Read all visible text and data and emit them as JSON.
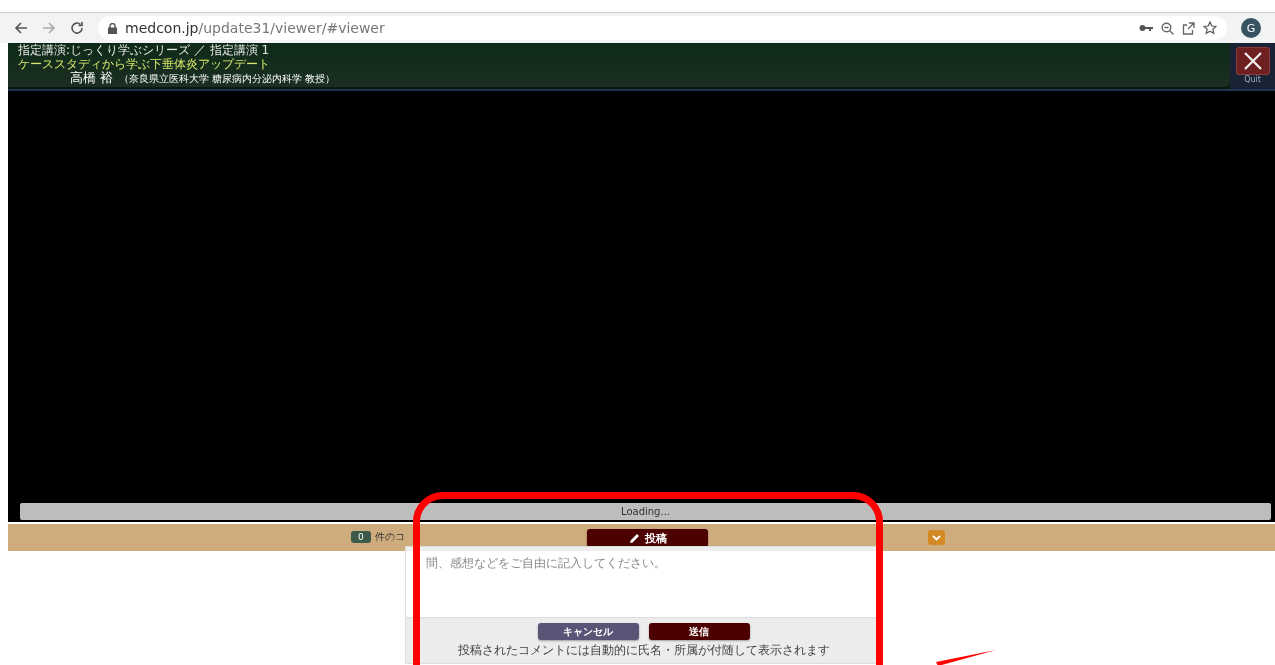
{
  "browser": {
    "url_host": "medcon.jp",
    "url_path": "/update31/viewer/#viewer",
    "profile": "G"
  },
  "header": {
    "series": "指定講演:じっくり学ぶシリーズ ／ 指定講演 1",
    "title": "ケーススタディから学ぶ下垂体炎アップデート",
    "speaker": "高橋 裕",
    "affiliation": "（奈良県立医科大学 糖尿病内分泌内科学 教授）",
    "quit": "Quit"
  },
  "player": {
    "loading": "Loading..."
  },
  "comment_bar": {
    "count": "0",
    "count_label": "件のコ",
    "post_button": "投稿"
  },
  "comment_form": {
    "placeholder": "間、感想などをご自由に記入してください。",
    "cancel": "キャンセル",
    "send": "送信",
    "note": "投稿されたコメントには自動的に氏名・所属が付随して表示されます"
  }
}
